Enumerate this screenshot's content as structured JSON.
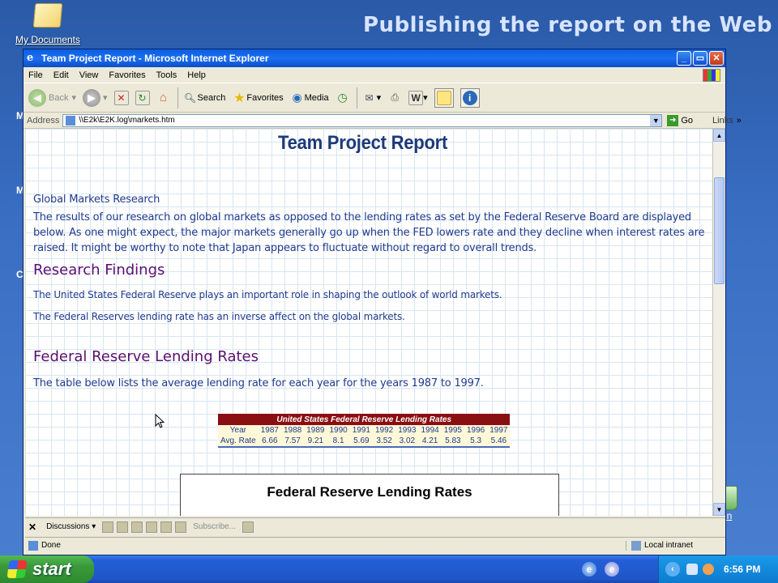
{
  "slide": {
    "title": "Publishing the report on the Web"
  },
  "desktop": {
    "my_documents": "My Documents",
    "side_letters": [
      "M",
      "M",
      "C"
    ],
    "recycle": "e Bin"
  },
  "window": {
    "title": "Team Project Report - Microsoft Internet Explorer",
    "buttons": {
      "minimize": "_",
      "maximize": "▭",
      "close": "✕"
    }
  },
  "menu": [
    "File",
    "Edit",
    "View",
    "Favorites",
    "Tools",
    "Help"
  ],
  "toolbar": {
    "back": "Back",
    "search": "Search",
    "favorites": "Favorites",
    "media": "Media"
  },
  "address": {
    "label": "Address",
    "value": "\\\\E2k\\E2K.log\\markets.htm",
    "go": "Go",
    "links": "Links"
  },
  "document": {
    "title": "Team Project Report",
    "section1_heading": "Global Markets Research",
    "section1_body": "The results of our research on global markets as opposed to the lending rates as set by the Federal Reserve Board are displayed below. As one might expect, the major markets generally go up when the FED lowers rate and they decline when interest rates are raised. It might be worthy to note that Japan appears to fluctuate without regard to overall trends.",
    "findings_heading": "Research Findings",
    "finding1": "The United States Federal Reserve plays an important role in shaping the outlook of world markets.",
    "finding2": "The Federal Reserves lending rate has an inverse affect on the global markets.",
    "rates_heading": "Federal Reserve Lending Rates",
    "rates_body": "The table below lists the average lending rate for each year for the years 1987 to 1997.",
    "chart_title": "Federal Reserve Lending Rates"
  },
  "rate_table": {
    "caption": "United States Federal Reserve Lending Rates",
    "row_labels": [
      "Year",
      "Avg. Rate"
    ],
    "years": [
      "1987",
      "1988",
      "1989",
      "1990",
      "1991",
      "1992",
      "1993",
      "1994",
      "1995",
      "1996",
      "1997"
    ],
    "rates": [
      "6.66",
      "7.57",
      "9.21",
      "8.1",
      "5.69",
      "3.52",
      "3.02",
      "4.21",
      "5.83",
      "5.3",
      "5.46"
    ]
  },
  "discussions": {
    "close": "✕",
    "label": "Discussions ▾",
    "subscribe": "Subscribe..."
  },
  "status": {
    "text": "Done",
    "zone": "Local intranet"
  },
  "taskbar": {
    "start": "start",
    "clock": "6:56 PM",
    "chevron": "‹"
  },
  "colors": {
    "heading_purple": "#5a0f6e",
    "body_blue": "#1f3a8c",
    "table_header": "#8a0f12",
    "table_cell": "#fff8d8"
  }
}
